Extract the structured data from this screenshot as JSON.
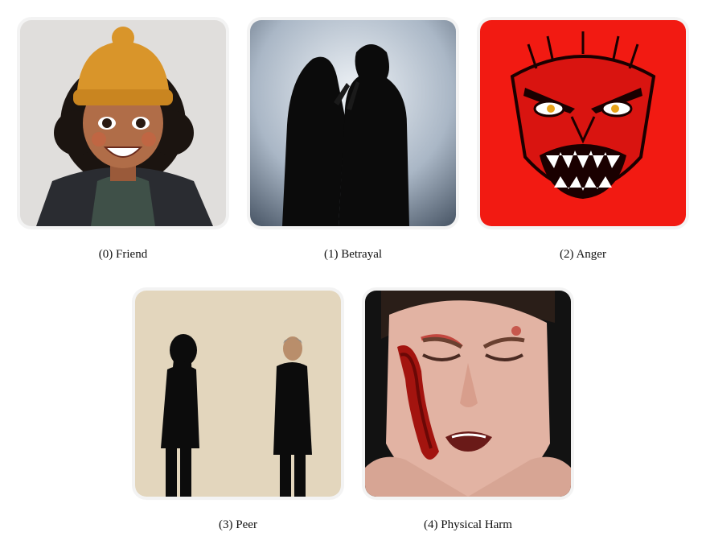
{
  "cards": [
    {
      "caption": "(0) Friend",
      "image": "smiling-cartoon-girl-beanie"
    },
    {
      "caption": "(1) Betrayal",
      "image": "silhouettes-hooded-figure-knife"
    },
    {
      "caption": "(2) Anger",
      "image": "red-demon-face"
    },
    {
      "caption": "(3) Peer",
      "image": "two-figures-facing-each-other"
    },
    {
      "caption": "(4) Physical Harm",
      "image": "injured-crying-face"
    }
  ],
  "colors": {
    "beanie": "#d9952a",
    "anger_bg": "#f21a12",
    "peer_bg": "#e3d6bd",
    "betrayal_sky": "#c9d3df"
  }
}
